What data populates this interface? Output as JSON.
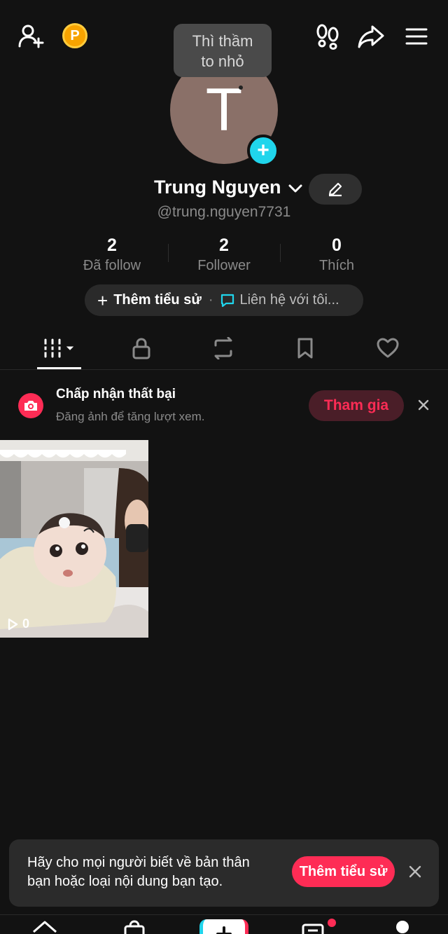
{
  "header": {
    "add_friend_icon": "person-add-icon",
    "coin_label": "P",
    "footprints_icon": "footprints-icon",
    "share_icon": "share-icon",
    "menu_icon": "hamburger-menu-icon"
  },
  "profile": {
    "avatar_letter": "T",
    "bubble_line1": "Thì thầm",
    "bubble_line2": "to nhỏ",
    "name": "Trung Nguyen",
    "handle": "@trung.nguyen7731",
    "stats": [
      {
        "value": "2",
        "label": "Đã follow"
      },
      {
        "value": "2",
        "label": "Follower"
      },
      {
        "value": "0",
        "label": "Thích"
      }
    ],
    "bio_add_label": "Thêm tiểu sử",
    "bio_separator": "·",
    "contact_label": "Liên hệ với tôi..."
  },
  "tabs": [
    {
      "icon": "grid-icon",
      "active": true
    },
    {
      "icon": "lock-icon",
      "active": false
    },
    {
      "icon": "repost-icon",
      "active": false
    },
    {
      "icon": "bookmark-icon",
      "active": false
    },
    {
      "icon": "heart-icon",
      "active": false
    }
  ],
  "challenge": {
    "title": "Chấp nhận thất bại",
    "subtitle": "Đăng ảnh để tăng lượt xem.",
    "join_label": "Tham gia",
    "close_icon": "close-icon"
  },
  "videos": [
    {
      "views": "0"
    }
  ],
  "toast": {
    "line1": "Hãy cho mọi người biết về bản thân",
    "line2": "bạn hoặc loại nội dung bạn tạo.",
    "button_label": "Thêm tiểu sử",
    "close_icon": "close-icon"
  },
  "colors": {
    "background": "#121212",
    "accent": "#fe2c55",
    "cyan": "#20d5ec",
    "muted_text": "#8a8a8a"
  }
}
